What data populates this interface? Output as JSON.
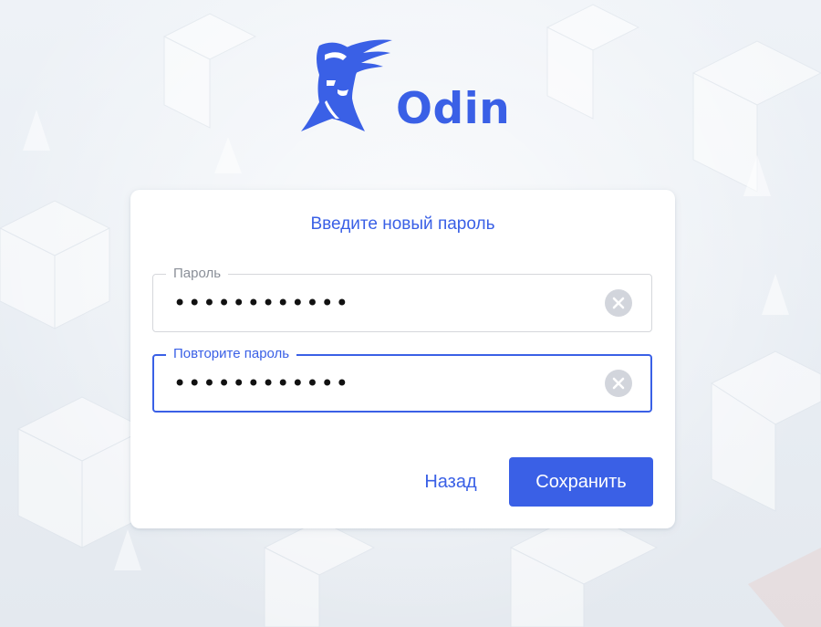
{
  "brand": {
    "name": "Odin",
    "color": "#3a60e6"
  },
  "form": {
    "title": "Введите новый пароль",
    "password": {
      "label": "Пароль",
      "value": "••••••••••••"
    },
    "confirm": {
      "label": "Повторите пароль",
      "value": "••••••••••••",
      "focused": true
    }
  },
  "actions": {
    "back_label": "Назад",
    "save_label": "Сохранить"
  },
  "icons": {
    "clear": "clear-circle-icon",
    "logo": "odin-winged-helmet-logo"
  }
}
